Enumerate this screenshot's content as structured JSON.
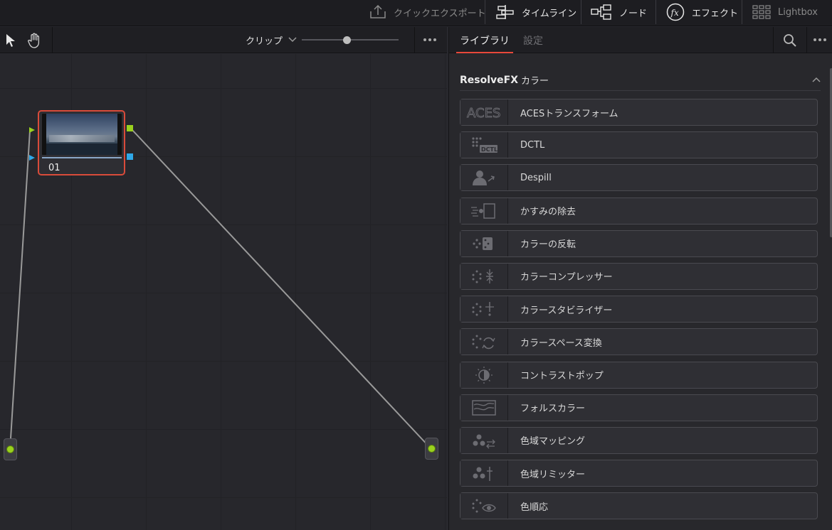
{
  "topbar": {
    "quick_export": "クイックエクスポート",
    "timeline": "タイムライン",
    "node": "ノード",
    "effects": "エフェクト",
    "lightbox": "Lightbox"
  },
  "node_toolbar": {
    "clip_mode": "クリップ"
  },
  "node": {
    "label": "01"
  },
  "panel": {
    "tabs": [
      {
        "label": "ライブラリ",
        "active": true
      },
      {
        "label": "設定",
        "active": false
      }
    ],
    "section_title": "ResolveFX",
    "section_title_sub": "カラー",
    "items": [
      {
        "label": "ACESトランスフォーム",
        "icon": "aces-icon"
      },
      {
        "label": "DCTL",
        "icon": "dctl-icon"
      },
      {
        "label": "Despill",
        "icon": "despill-icon"
      },
      {
        "label": "かすみの除去",
        "icon": "dehaze-icon"
      },
      {
        "label": "カラーの反転",
        "icon": "invert-color-icon"
      },
      {
        "label": "カラーコンプレッサー",
        "icon": "color-compressor-icon"
      },
      {
        "label": "カラースタビライザー",
        "icon": "color-stabilizer-icon"
      },
      {
        "label": "カラースペース変換",
        "icon": "color-space-transform-icon"
      },
      {
        "label": "コントラストポップ",
        "icon": "contrast-pop-icon"
      },
      {
        "label": "フォルスカラー",
        "icon": "false-color-icon"
      },
      {
        "label": "色域マッピング",
        "icon": "gamut-mapping-icon"
      },
      {
        "label": "色域リミッター",
        "icon": "gamut-limiter-icon"
      },
      {
        "label": "色順応",
        "icon": "chromatic-adaptation-icon"
      }
    ]
  },
  "colors": {
    "accent_red": "#e8483a",
    "node_port_green": "#9ad11e",
    "node_port_blue": "#2fa8e8"
  }
}
